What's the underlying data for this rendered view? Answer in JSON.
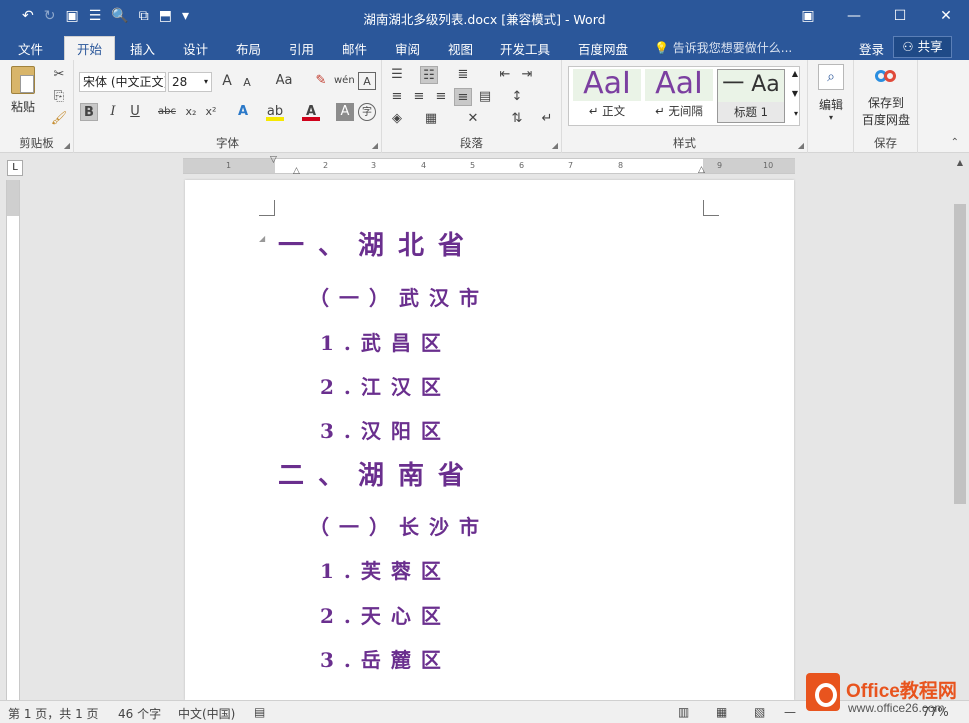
{
  "window": {
    "title": "湖南湖北多级列表.docx [兼容模式] - Word",
    "controls": {
      "ribbon_display": "▣",
      "minimize": "—",
      "restore": "☐",
      "close": "✕"
    }
  },
  "quick_access": {
    "undo": "↶",
    "redo": "↻",
    "save": "💾",
    "touch": "☰",
    "preview": "🔍",
    "customize": "▾"
  },
  "tabs": [
    "文件",
    "开始",
    "插入",
    "设计",
    "布局",
    "引用",
    "邮件",
    "审阅",
    "视图",
    "开发工具",
    "百度网盘"
  ],
  "active_tab": "开始",
  "tell_me": "告诉我您想要做什么...",
  "account": {
    "login": "登录",
    "share": "共享"
  },
  "ribbon": {
    "clipboard": {
      "label": "剪贴板",
      "paste": "粘贴"
    },
    "font": {
      "label": "字体",
      "font_name": "宋体 (中文正文)",
      "font_size": "28",
      "grow": "A",
      "shrink": "A",
      "case": "Aa",
      "bold": "B",
      "italic": "I",
      "underline": "U",
      "strikethrough": "abc",
      "subscript": "x₂",
      "superscript": "x²"
    },
    "paragraph": {
      "label": "段落"
    },
    "styles": {
      "label": "样式",
      "items": [
        {
          "preview": "AaI",
          "name": "↵ 正文"
        },
        {
          "preview": "AaI",
          "name": "↵ 无间隔"
        },
        {
          "preview": "一 Aa",
          "name": "标题 1"
        }
      ]
    },
    "editing": {
      "label": "编辑"
    },
    "save_group": {
      "label": "保存",
      "button_line1": "保存到",
      "button_line2": "百度网盘"
    }
  },
  "document": {
    "lines": [
      {
        "level": 1,
        "text": "一、湖北省"
      },
      {
        "level": 2,
        "text": "（一）武汉市"
      },
      {
        "level": 3,
        "text": "1.武昌区"
      },
      {
        "level": 3,
        "text": "2.江汉区"
      },
      {
        "level": 3,
        "text": "3.汉阳区"
      },
      {
        "level": 1,
        "text": "二、湖南省"
      },
      {
        "level": 2,
        "text": "（一）长沙市"
      },
      {
        "level": 3,
        "text": "1.芙蓉区"
      },
      {
        "level": 3,
        "text": "2.天心区"
      },
      {
        "level": 3,
        "text": "3.岳麓区"
      }
    ],
    "text_color": "#6a2f8e"
  },
  "ruler": {
    "h_ticks": [
      "1",
      "2",
      "3",
      "4",
      "5",
      "6",
      "7",
      "8",
      "9",
      "10"
    ],
    "corner": "L"
  },
  "status_bar": {
    "page": "第 1 页，共 1 页",
    "words": "46 个字",
    "language": "中文(中国)",
    "zoom": "77%"
  },
  "watermark": {
    "brand": "Office教程网",
    "url": "www.office26.com"
  }
}
